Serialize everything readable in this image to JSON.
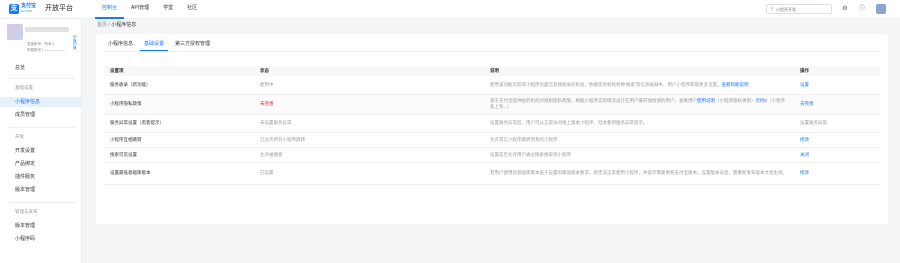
{
  "topbar": {
    "logo_mark": "支",
    "logo_text": "支付宝",
    "logo_sub": "ALIPAY",
    "platform_title": "开放平台",
    "nav": [
      "控制台",
      "API管理",
      "学堂",
      "社区"
    ],
    "search_placeholder": "小程序开发"
  },
  "sidebar": {
    "app_meta": [
      "发版帐号：所有人",
      "所属账号 | ——————"
    ],
    "app_links": [
      "切换",
      "切换"
    ],
    "overview": "总览",
    "section_basic": "基础设置",
    "basic_items": [
      "小程序信息",
      "成员管理"
    ],
    "section_dev": "开发",
    "dev_items": [
      "开发设置",
      "产品绑定",
      "插件服务",
      "版本管理"
    ],
    "section_publish": "管理与发布",
    "publish_items": [
      "版本管理",
      "小程序码"
    ]
  },
  "breadcrumb": {
    "root": "首页",
    "sep": "/",
    "current": "小程序信息"
  },
  "tabs": [
    "小程序信息",
    "基础设置",
    "第三方授权管理"
  ],
  "table": {
    "headers": [
      "设置项",
      "状态",
      "说明",
      "操作"
    ],
    "rows": [
      {
        "name": "服务收录（新功能）",
        "status": "使用中",
        "desc": "使用该功能可获得小程序页面信息搜收录的机会，依据您的机构各种‘搜索’等信息被缺失、用户小程序获取更多流量。",
        "link": "查看和能说明",
        "op": "设置"
      },
      {
        "name": "小程序隐私政策",
        "status": "未完善",
        "desc": "基于支付宝提供给的机构对规则隐私政策，根据小程序实际情况设计在用户最开放搜请的用户，查看用户",
        "link": "使用说明",
        "desc2": "（小程序隐私弹窗）",
        "link2": "示例2",
        "desc3": "（小程序名上有...）",
        "op": "去完善"
      },
      {
        "name": "服务异常设置（黑客提示）",
        "status": "未设置服务异常",
        "desc": "设置服务异常后，用户可以正常访问线上版本小程序，但会看到服务异常提示。",
        "link": "",
        "op": "设置服务异常"
      },
      {
        "name": "小程序互相跳转",
        "status": "已允许所有小程序跳转",
        "desc": "允许其它小程序跳转到我的小程序",
        "link": "",
        "op": "修改"
      },
      {
        "name": "搜索可见设置",
        "status": "允许被搜索",
        "desc": "设置是否允许用户通过搜索搜索到小程序",
        "link": "",
        "op": "关闭"
      },
      {
        "name": "设置最低基础库版本",
        "status": "已设置",
        "desc": "若用户使用的基础库版本低于设置的最低版本要求，将无法正常使用小程序，并提示需要更新支付宝版本。设置版本号后，需重新发布版本才会生效。",
        "link": "",
        "op": "修改"
      }
    ]
  },
  "colors": {
    "accent": "#1677ff",
    "warn": "#e02020"
  },
  "icons": [
    "search-icon",
    "settings-icon",
    "help-icon",
    "user-avatar"
  ]
}
